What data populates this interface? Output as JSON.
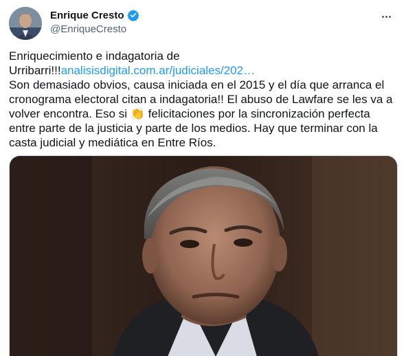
{
  "author": {
    "display_name": "Enrique Cresto",
    "handle": "@EnriqueCresto",
    "verified_icon": "verified-badge-icon",
    "avatar_icon": "profile-photo"
  },
  "menu": {
    "icon": "more-options-icon"
  },
  "tweet": {
    "line1": "Enriquecimiento e indagatoria de",
    "line2_prefix": "Urribarri!!!",
    "link_text": "analisisdigital.com.ar/judiciales/202…",
    "line3": "Son demasiado obvios, causa iniciada en el 2015 y el día que arranca el cronograma electoral citan a indagatoria!! El abuso de Lawfare se les va a volver encontra. Eso si ",
    "emoji": "👏",
    "line3_suffix": " felicitaciones por la sincronización perfecta entre parte de la justicia y parte de los medios. Hay que terminar con la casta judicial y mediática en Entre Ríos."
  },
  "media": {
    "icon": "photo-of-man"
  },
  "colors": {
    "link": "#1d9bf0",
    "text": "#0f1419",
    "secondary": "#536471",
    "verified": "#1d9bf0"
  }
}
